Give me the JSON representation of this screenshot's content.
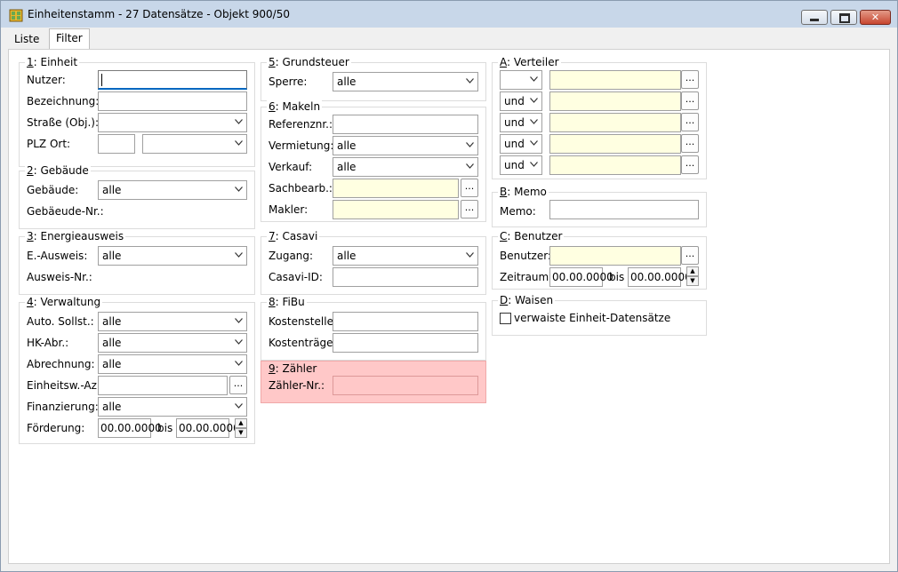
{
  "window": {
    "title": "Einheitenstamm - 27 Datensätze - Objekt 900/50"
  },
  "tabs": [
    {
      "label": "Liste"
    },
    {
      "label": "Filter"
    }
  ],
  "einheit": {
    "num": "1",
    "title": ": Einheit",
    "nutzer_label": "Nutzer:",
    "nutzer_value": "",
    "bezeichnung_label": "Bezeichnung:",
    "bezeichnung_value": "",
    "strasse_label": "Straße (Obj.):",
    "strasse_value": "",
    "plzort_label": "PLZ Ort:",
    "plz_value": "",
    "ort_value": ""
  },
  "gebaeude": {
    "num": "2",
    "title": ": Gebäude",
    "gebaeude_label": "Gebäude:",
    "gebaeude_value": "alle",
    "gebaeude_nr_label": "Gebäeude-Nr.:"
  },
  "energie": {
    "num": "3",
    "title": ": Energieausweis",
    "ausweis_label": "E.-Ausweis:",
    "ausweis_value": "alle",
    "ausweis_nr_label": "Ausweis-Nr.:"
  },
  "verwaltung": {
    "num": "4",
    "title": ": Verwaltung",
    "sollst_label": "Auto. Sollst.:",
    "sollst_value": "alle",
    "hk_label": "HK-Abr.:",
    "hk_value": "alle",
    "abrechnung_label": "Abrechnung:",
    "abrechnung_value": "alle",
    "einheitsw_label": "Einheitsw.-Az:",
    "einheitsw_value": "",
    "finanzierung_label": "Finanzierung:",
    "finanzierung_value": "alle",
    "foerderung_label": "Förderung:",
    "foerderung_from": "00.00.0000",
    "bis_label": "bis",
    "foerderung_to": "00.00.0000"
  },
  "grundsteuer": {
    "num": "5",
    "title": ": Grundsteuer",
    "sperre_label": "Sperre:",
    "sperre_value": "alle"
  },
  "makeln": {
    "num": "6",
    "title": ": Makeln",
    "referenz_label": "Referenznr.:",
    "referenz_value": "",
    "vermietung_label": "Vermietung:",
    "vermietung_value": "alle",
    "verkauf_label": "Verkauf:",
    "verkauf_value": "alle",
    "sachbearb_label": "Sachbearb.:",
    "sachbearb_value": "",
    "makler_label": "Makler:",
    "makler_value": ""
  },
  "casavi": {
    "num": "7",
    "title": ": Casavi",
    "zugang_label": "Zugang:",
    "zugang_value": "alle",
    "casavi_id_label": "Casavi-ID:",
    "casavi_id_value": ""
  },
  "fibu": {
    "num": "8",
    "title": ": FiBu",
    "kostenstelle_label": "Kostenstelle:",
    "kostenstelle_value": "",
    "kostentraeger_label": "Kostenträger:",
    "kostentraeger_value": ""
  },
  "zaehler": {
    "num": "9",
    "title": ": Zähler",
    "zaehler_nr_label": "Zähler-Nr.:",
    "zaehler_nr_value": ""
  },
  "verteiler": {
    "letter": "A",
    "title": ": Verteiler",
    "rows": [
      {
        "op": "",
        "value": ""
      },
      {
        "op": "und",
        "value": ""
      },
      {
        "op": "und",
        "value": ""
      },
      {
        "op": "und",
        "value": ""
      },
      {
        "op": "und",
        "value": ""
      }
    ]
  },
  "memo": {
    "letter": "B",
    "title": ": Memo",
    "memo_label": "Memo:",
    "memo_value": ""
  },
  "benutzer": {
    "letter": "C",
    "title": ": Benutzer",
    "benutzer_label": "Benutzer:",
    "benutzer_value": "",
    "zeitraum_label": "Zeitraum:",
    "zeitraum_from": "00.00.0000",
    "bis_label": "bis",
    "zeitraum_to": "00.00.0000"
  },
  "waisen": {
    "letter": "D",
    "title": ": Waisen",
    "checkbox_label": "verwaiste Einheit-Datensätze"
  },
  "browse_label": "...",
  "colors": {
    "titlebar": "#c8d7e9",
    "highlight": "#ffc8c8",
    "yellow_field": "#ffffe1",
    "focus": "#0067c0"
  }
}
